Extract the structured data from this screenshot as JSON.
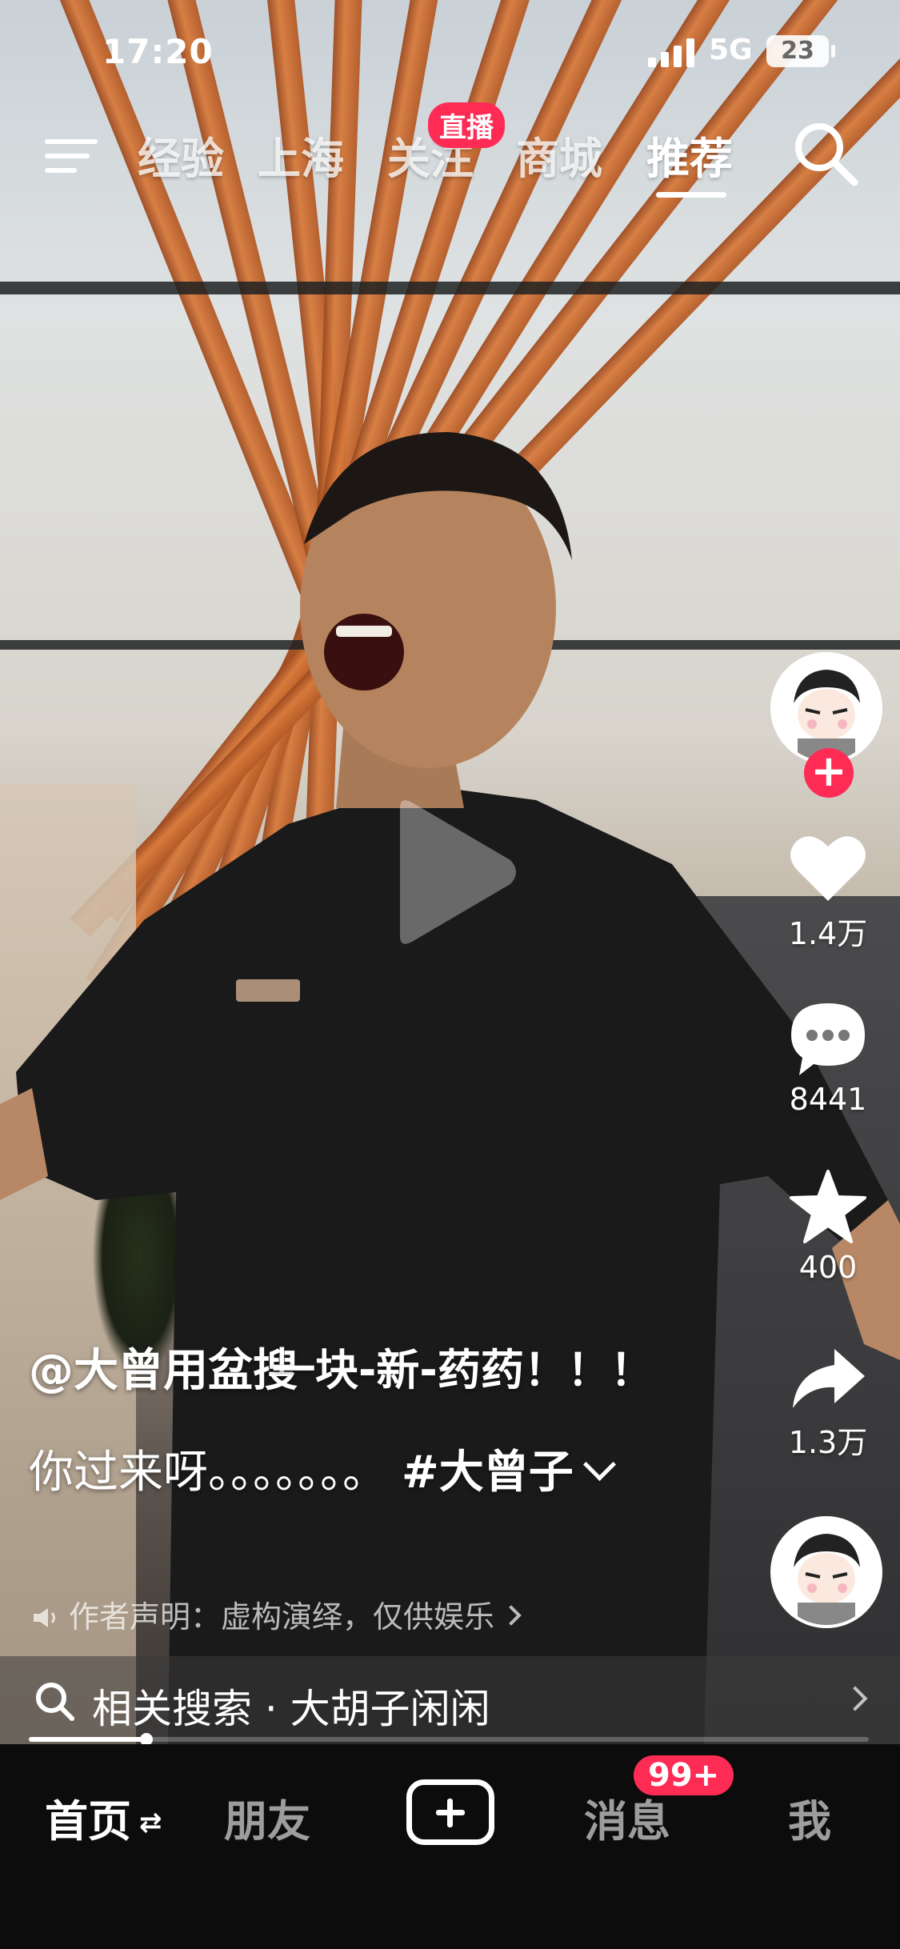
{
  "status_bar": {
    "time": "17:20",
    "network": "5G",
    "battery": "23"
  },
  "top_nav": {
    "tabs": [
      {
        "label": "经验",
        "active": false
      },
      {
        "label": "上海",
        "active": false
      },
      {
        "label": "关注",
        "active": false
      },
      {
        "label": "商城",
        "active": false
      },
      {
        "label": "推荐",
        "active": true
      }
    ],
    "live_badge": "直播",
    "icons": [
      "menu-icon",
      "search-icon"
    ]
  },
  "video": {
    "author": "@大曾用盆搜",
    "title_overlay": "一块-新-药药！！！",
    "caption_text": "你过来呀。。。。。。。",
    "hashtag": "#大曾子",
    "disclaimer": "作者声明：虚构演绎，仅供娱乐",
    "playback_progress": 0.14
  },
  "actions": {
    "likes": "1.4万",
    "comments": "8441",
    "favorites": "400",
    "shares": "1.3万"
  },
  "related_search": {
    "label": "相关搜索 · 大胡子闲闲"
  },
  "bottom_nav": {
    "items": [
      {
        "label": "首页",
        "active": true
      },
      {
        "label": "朋友",
        "active": false
      },
      {
        "label": "消息",
        "active": false
      },
      {
        "label": "我",
        "active": false
      }
    ],
    "message_badge": "99+"
  },
  "colors": {
    "accent": "#fe2c55",
    "nav_bg": "#0c0c0c"
  }
}
